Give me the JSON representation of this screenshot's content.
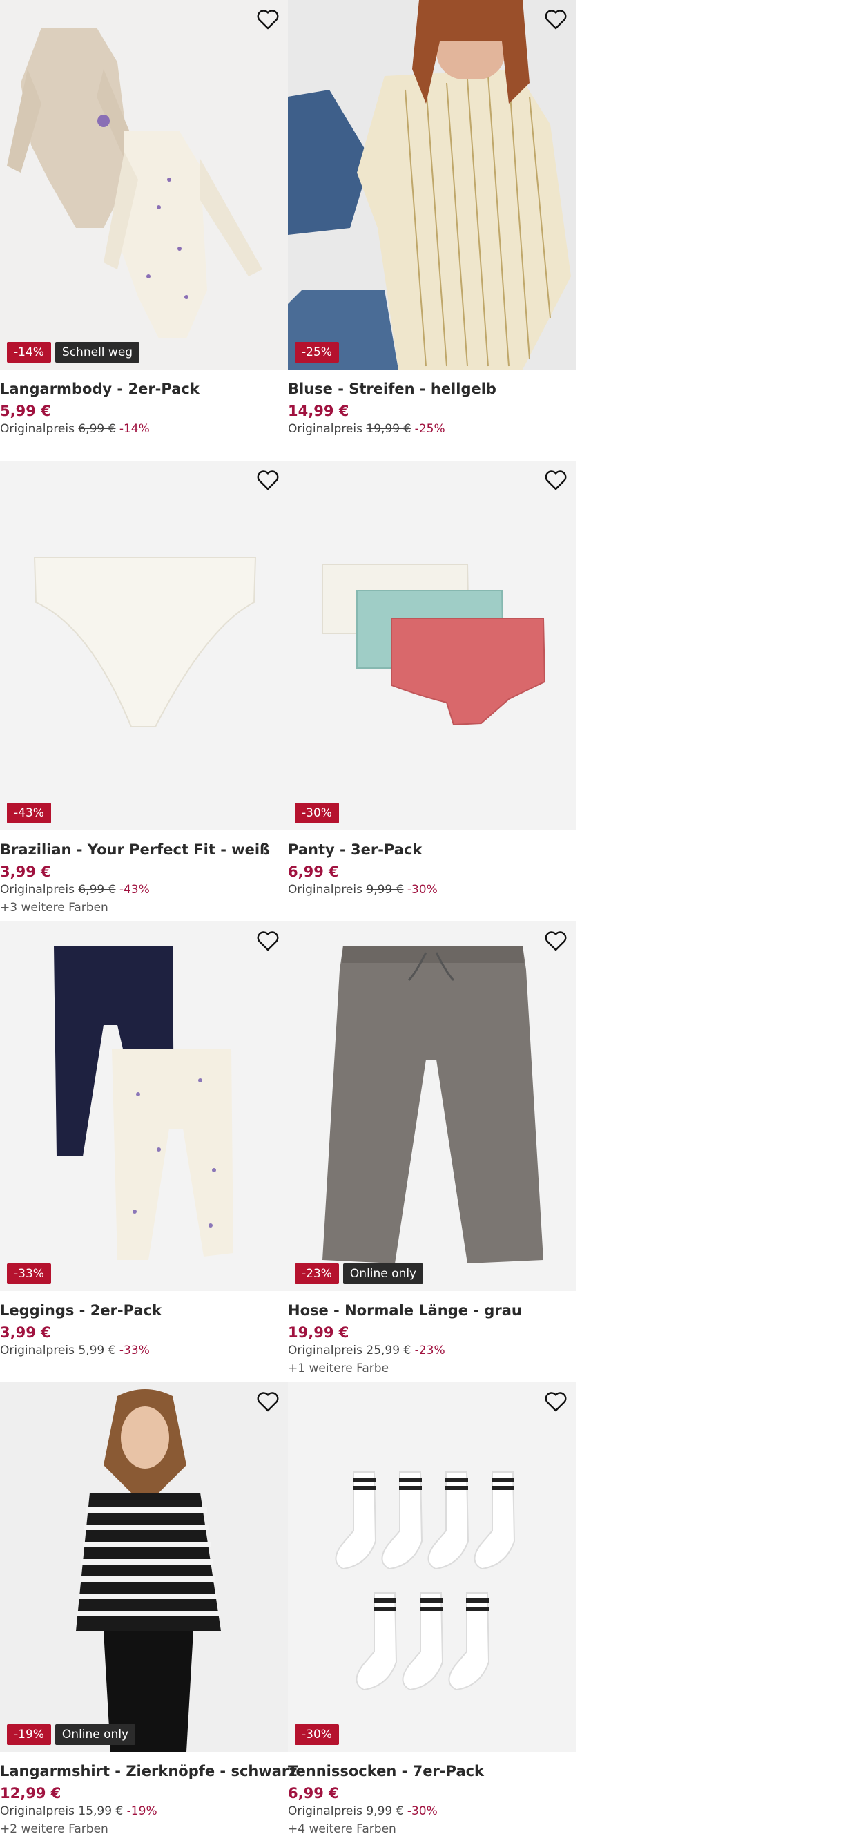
{
  "products": [
    {
      "title": "Langarmbody - 2er-Pack",
      "price": "5,99 €",
      "orig_label": "Originalpreis",
      "orig_price": "6,99 €",
      "discount": "-14%",
      "badges": [
        "-14%",
        "Schnell weg"
      ],
      "more_colors": "",
      "image": "baby-bodysuits"
    },
    {
      "title": "Bluse - Streifen - hellgelb",
      "price": "14,99 €",
      "orig_label": "Originalpreis",
      "orig_price": "19,99 €",
      "discount": "-25%",
      "badges": [
        "-25%"
      ],
      "more_colors": "",
      "image": "striped-blouse-model"
    },
    {
      "title": "Brazilian - Your Perfect Fit - weiß",
      "price": "3,99 €",
      "orig_label": "Originalpreis",
      "orig_price": "6,99 €",
      "discount": "-43%",
      "badges": [
        "-43%"
      ],
      "more_colors": "+3 weitere Farben",
      "image": "white-brief"
    },
    {
      "title": "Panty - 3er-Pack",
      "price": "6,99 €",
      "orig_label": "Originalpreis",
      "orig_price": "9,99 €",
      "discount": "-30%",
      "badges": [
        "-30%"
      ],
      "more_colors": "",
      "image": "panty-three-pack"
    },
    {
      "title": "Leggings - 2er-Pack",
      "price": "3,99 €",
      "orig_label": "Originalpreis",
      "orig_price": "5,99 €",
      "discount": "-33%",
      "badges": [
        "-33%"
      ],
      "more_colors": "",
      "image": "baby-leggings"
    },
    {
      "title": "Hose - Normale Länge - grau",
      "price": "19,99 €",
      "orig_label": "Originalpreis",
      "orig_price": "25,99 €",
      "discount": "-23%",
      "badges": [
        "-23%",
        "Online only"
      ],
      "more_colors": "+1 weitere Farbe",
      "image": "grey-wide-pants"
    },
    {
      "title": "Langarmshirt - Zierknöpfe - schwarz",
      "price": "12,99 €",
      "orig_label": "Originalpreis",
      "orig_price": "15,99 €",
      "discount": "-19%",
      "badges": [
        "-19%",
        "Online only"
      ],
      "more_colors": "+2 weitere Farben",
      "image": "striped-shirt-model"
    },
    {
      "title": "Tennissocken - 7er-Pack",
      "price": "6,99 €",
      "orig_label": "Originalpreis",
      "orig_price": "9,99 €",
      "discount": "-30%",
      "badges": [
        "-30%"
      ],
      "more_colors": "+4 weitere Farben",
      "image": "tennis-socks"
    }
  ],
  "colors": {
    "sale": "#b5122e",
    "price": "#a0123f",
    "badge_dark": "#2b2b2b",
    "image_bg": "#f3f3f3"
  },
  "icons": {
    "favorite": "heart-outline-icon"
  }
}
